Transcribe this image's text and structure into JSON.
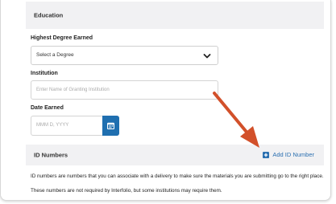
{
  "education": {
    "header": "Education",
    "degree_label": "Highest Degree Earned",
    "degree_value": "Select a Degree",
    "institution_label": "Institution",
    "institution_placeholder": "Enter Name of Granting Institution",
    "date_label": "Date Earned",
    "date_placeholder": "MMM D, YYYY"
  },
  "id_numbers": {
    "header": "ID Numbers",
    "add_label": "Add ID Number",
    "description_1": "ID numbers are numbers that you can associate with a delivery to make sure the materials you are submitting go to the right place.",
    "description_2": "These numbers are not required by Interfolio, but some institutions may require them."
  },
  "annotation": {
    "arrow_color": "#d2502a"
  },
  "icons": [
    "chevron-down-icon",
    "calendar-icon",
    "plus-square-icon",
    "arrow-annotation"
  ],
  "colors": {
    "accent": "#1f6fb0",
    "link": "#2a6fb0",
    "header_bg": "#f1f1f3"
  }
}
